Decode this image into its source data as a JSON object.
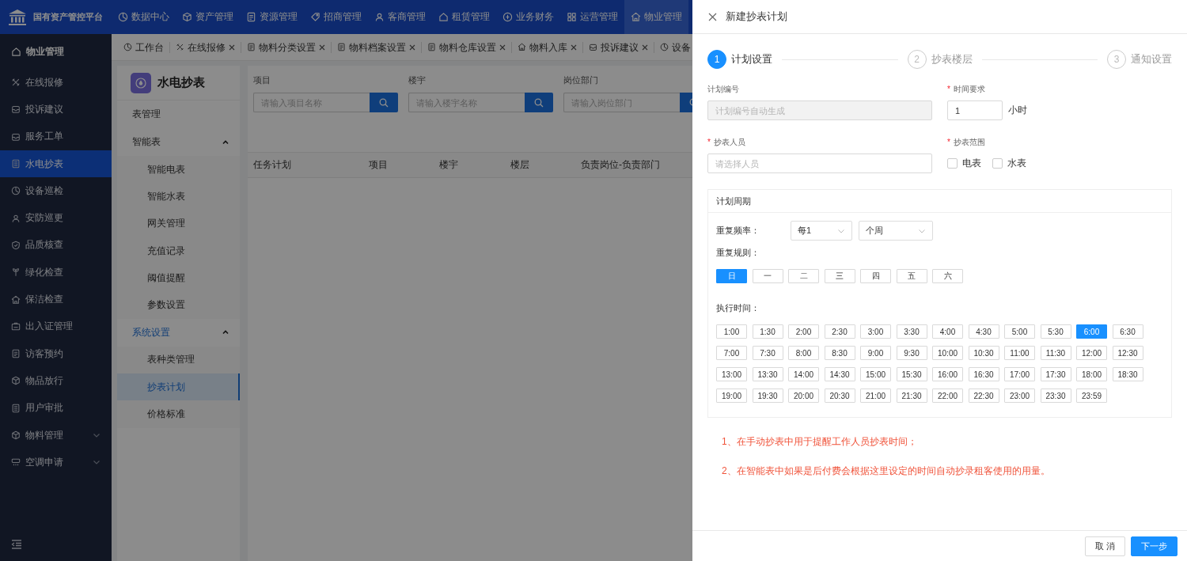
{
  "app": {
    "title": "国有资产管控平台"
  },
  "top_nav": [
    {
      "label": "数据中心",
      "selected": false
    },
    {
      "label": "资产管理",
      "selected": false
    },
    {
      "label": "资源管理",
      "selected": false
    },
    {
      "label": "招商管理",
      "selected": false
    },
    {
      "label": "客商管理",
      "selected": false
    },
    {
      "label": "租赁管理",
      "selected": false
    },
    {
      "label": "业务财务",
      "selected": false
    },
    {
      "label": "运营管理",
      "selected": false
    },
    {
      "label": "物业管理",
      "selected": true
    }
  ],
  "tabs": [
    {
      "label": "工作台",
      "closable": false
    },
    {
      "label": "在线报修",
      "closable": true
    },
    {
      "label": "物料分类设置",
      "closable": true
    },
    {
      "label": "物料档案设置",
      "closable": true
    },
    {
      "label": "物料仓库设置",
      "closable": true
    },
    {
      "label": "物料入库",
      "closable": true
    },
    {
      "label": "投诉建议",
      "closable": true
    },
    {
      "label": "设备",
      "closable": false
    }
  ],
  "sidebar": {
    "header": "物业管理",
    "items": [
      {
        "label": "在线报修",
        "selected": false,
        "has_submenu": false
      },
      {
        "label": "投诉建议",
        "selected": false,
        "has_submenu": false
      },
      {
        "label": "服务工单",
        "selected": false,
        "has_submenu": false
      },
      {
        "label": "水电抄表",
        "selected": true,
        "has_submenu": false
      },
      {
        "label": "设备巡检",
        "selected": false,
        "has_submenu": false
      },
      {
        "label": "安防巡更",
        "selected": false,
        "has_submenu": false
      },
      {
        "label": "品质核查",
        "selected": false,
        "has_submenu": false
      },
      {
        "label": "绿化检查",
        "selected": false,
        "has_submenu": false
      },
      {
        "label": "保洁检查",
        "selected": false,
        "has_submenu": false
      },
      {
        "label": "出入证管理",
        "selected": false,
        "has_submenu": false
      },
      {
        "label": "访客预约",
        "selected": false,
        "has_submenu": false
      },
      {
        "label": "物品放行",
        "selected": false,
        "has_submenu": false
      },
      {
        "label": "用户审批",
        "selected": false,
        "has_submenu": false
      },
      {
        "label": "物料管理",
        "selected": false,
        "has_submenu": true
      },
      {
        "label": "空调申请",
        "selected": false,
        "has_submenu": true
      }
    ]
  },
  "submenu": {
    "title": "水电抄表",
    "items": [
      {
        "label": "表管理",
        "selected": false
      },
      {
        "label": "智能表",
        "selected": false,
        "expanded": true,
        "children": [
          {
            "label": "智能电表",
            "selected": false
          },
          {
            "label": "智能水表",
            "selected": false
          },
          {
            "label": "网关管理",
            "selected": false
          },
          {
            "label": "充值记录",
            "selected": false
          },
          {
            "label": "阈值提醒",
            "selected": false
          },
          {
            "label": "参数设置",
            "selected": false
          }
        ]
      },
      {
        "label": "系统设置",
        "selected": true,
        "expanded": true,
        "children": [
          {
            "label": "表种类管理",
            "selected": false
          },
          {
            "label": "抄表计划",
            "selected": true
          },
          {
            "label": "价格标准",
            "selected": false
          }
        ]
      }
    ]
  },
  "filters": [
    {
      "label": "项目",
      "placeholder": "请输入项目名称"
    },
    {
      "label": "楼宇",
      "placeholder": "请输入楼宇名称"
    },
    {
      "label": "岗位部门",
      "placeholder": "请输入岗位部门"
    }
  ],
  "table": {
    "columns": [
      "任务计划",
      "项目",
      "楼宇",
      "楼层",
      "负责岗位-负责部门"
    ]
  },
  "drawer": {
    "title": "新建抄表计划",
    "steps": [
      {
        "number": "1",
        "label": "计划设置",
        "selected": true
      },
      {
        "number": "2",
        "label": "抄表楼层",
        "selected": false
      },
      {
        "number": "3",
        "label": "通知设置",
        "selected": false
      }
    ],
    "plan_number": {
      "label": "计划编号",
      "placeholder": "计划编号自动生成",
      "disabled": true
    },
    "time_requirement": {
      "required_mark": "*",
      "label": "时间要求",
      "value": "1",
      "unit": "小时"
    },
    "reader": {
      "required_mark": "*",
      "label": "抄表人员",
      "placeholder": "请选择人员"
    },
    "scope": {
      "required_mark": "*",
      "label": "抄表范围",
      "options": [
        {
          "label": "电表",
          "checked": false
        },
        {
          "label": "水表",
          "checked": false
        }
      ]
    },
    "cycle": {
      "title": "计划周期",
      "frequency_label": "重复频率：",
      "frequency_selects": [
        "每1",
        "个周"
      ],
      "rule_label": "重复规则：",
      "days": [
        {
          "label": "日",
          "selected": true
        },
        {
          "label": "一",
          "selected": false
        },
        {
          "label": "二",
          "selected": false
        },
        {
          "label": "三",
          "selected": false
        },
        {
          "label": "四",
          "selected": false
        },
        {
          "label": "五",
          "selected": false
        },
        {
          "label": "六",
          "selected": false
        }
      ],
      "time_label": "执行时间：",
      "times": [
        {
          "label": "1:00",
          "selected": false
        },
        {
          "label": "1:30",
          "selected": false
        },
        {
          "label": "2:00",
          "selected": false
        },
        {
          "label": "2:30",
          "selected": false
        },
        {
          "label": "3:00",
          "selected": false
        },
        {
          "label": "3:30",
          "selected": false
        },
        {
          "label": "4:00",
          "selected": false
        },
        {
          "label": "4:30",
          "selected": false
        },
        {
          "label": "5:00",
          "selected": false
        },
        {
          "label": "5:30",
          "selected": false
        },
        {
          "label": "6:00",
          "selected": true
        },
        {
          "label": "6:30",
          "selected": false
        },
        {
          "label": "7:00",
          "selected": false
        },
        {
          "label": "7:30",
          "selected": false
        },
        {
          "label": "8:00",
          "selected": false
        },
        {
          "label": "8:30",
          "selected": false
        },
        {
          "label": "9:00",
          "selected": false
        },
        {
          "label": "9:30",
          "selected": false
        },
        {
          "label": "10:00",
          "selected": false
        },
        {
          "label": "10:30",
          "selected": false
        },
        {
          "label": "11:00",
          "selected": false
        },
        {
          "label": "11:30",
          "selected": false
        },
        {
          "label": "12:00",
          "selected": false
        },
        {
          "label": "12:30",
          "selected": false
        },
        {
          "label": "13:00",
          "selected": false
        },
        {
          "label": "13:30",
          "selected": false
        },
        {
          "label": "14:00",
          "selected": false
        },
        {
          "label": "14:30",
          "selected": false
        },
        {
          "label": "15:00",
          "selected": false
        },
        {
          "label": "15:30",
          "selected": false
        },
        {
          "label": "16:00",
          "selected": false
        },
        {
          "label": "16:30",
          "selected": false
        },
        {
          "label": "17:00",
          "selected": false
        },
        {
          "label": "17:30",
          "selected": false
        },
        {
          "label": "18:00",
          "selected": false
        },
        {
          "label": "18:30",
          "selected": false
        },
        {
          "label": "19:00",
          "selected": false
        },
        {
          "label": "19:30",
          "selected": false
        },
        {
          "label": "20:00",
          "selected": false
        },
        {
          "label": "20:30",
          "selected": false
        },
        {
          "label": "21:00",
          "selected": false
        },
        {
          "label": "21:30",
          "selected": false
        },
        {
          "label": "22:00",
          "selected": false
        },
        {
          "label": "22:30",
          "selected": false
        },
        {
          "label": "23:00",
          "selected": false
        },
        {
          "label": "23:30",
          "selected": false
        },
        {
          "label": "23:59",
          "selected": false
        }
      ]
    },
    "notes": [
      "1、在手动抄表中用于提醒工作人员抄表时间；",
      "2、在智能表中如果是后付费会根据这里设定的时间自动抄录租客使用的用量。"
    ],
    "buttons": [
      {
        "label": "取 消",
        "kind": "secondary"
      },
      {
        "label": "下一步",
        "kind": "primary"
      }
    ]
  }
}
